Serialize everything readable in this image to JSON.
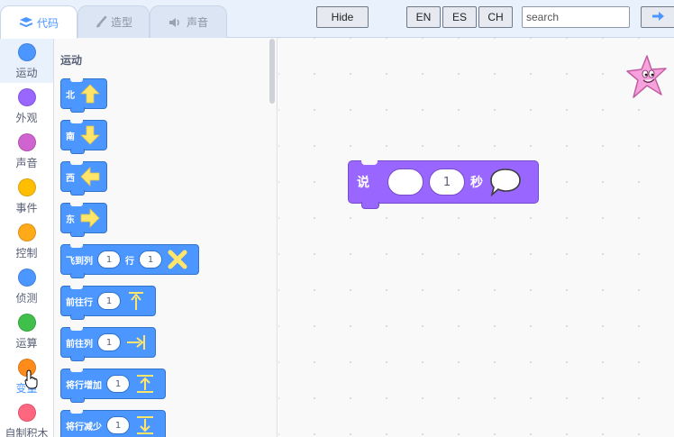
{
  "tabs": [
    {
      "label": "代码",
      "icon": "code-icon",
      "active": true
    },
    {
      "label": "造型",
      "icon": "brush-icon",
      "active": false
    },
    {
      "label": "声音",
      "icon": "speaker-icon",
      "active": false
    }
  ],
  "toolbar": {
    "hide_label": "Hide",
    "lang_en": "EN",
    "lang_es": "ES",
    "lang_ch": "CH",
    "search_placeholder": "search",
    "go_icon": "arrow-right-icon"
  },
  "categories": [
    {
      "label": "运动",
      "color": "#4c97ff"
    },
    {
      "label": "外观",
      "color": "#9966ff"
    },
    {
      "label": "声音",
      "color": "#cf63cf"
    },
    {
      "label": "事件",
      "color": "#ffbf00"
    },
    {
      "label": "控制",
      "color": "#ffab19"
    },
    {
      "label": "侦测",
      "color": "#4c97ff"
    },
    {
      "label": "运算",
      "color": "#40bf4a"
    },
    {
      "label": "变量",
      "color": "#ff8c1a"
    },
    {
      "label": "自制积木",
      "color": "#ff6680"
    }
  ],
  "palette": {
    "title": "运动",
    "blocks": [
      {
        "text": "北",
        "icon": "arrow-up-icon"
      },
      {
        "text": "南",
        "icon": "arrow-down-icon"
      },
      {
        "text": "西",
        "icon": "arrow-left-icon"
      },
      {
        "text": "东",
        "icon": "arrow-right-icon"
      },
      {
        "text": "飞到列",
        "value1": "1",
        "text2": "行",
        "value2": "1",
        "icon": "fly-x-icon"
      },
      {
        "text": "前往行",
        "value": "1",
        "icon": "goto-row-icon"
      },
      {
        "text": "前往列",
        "value": "1",
        "icon": "goto-col-icon"
      },
      {
        "text": "将行增加",
        "value": "1",
        "icon": "row-increase-icon"
      },
      {
        "text": "将行减少",
        "value": "1",
        "icon": "row-decrease-icon"
      }
    ]
  },
  "workspace": {
    "say_block": {
      "label": "说",
      "value": "1",
      "unit": "秒",
      "icon": "speech-bubble-icon",
      "color": "#9966ff"
    }
  },
  "sprite": {
    "icon": "starfish-sprite-icon"
  }
}
